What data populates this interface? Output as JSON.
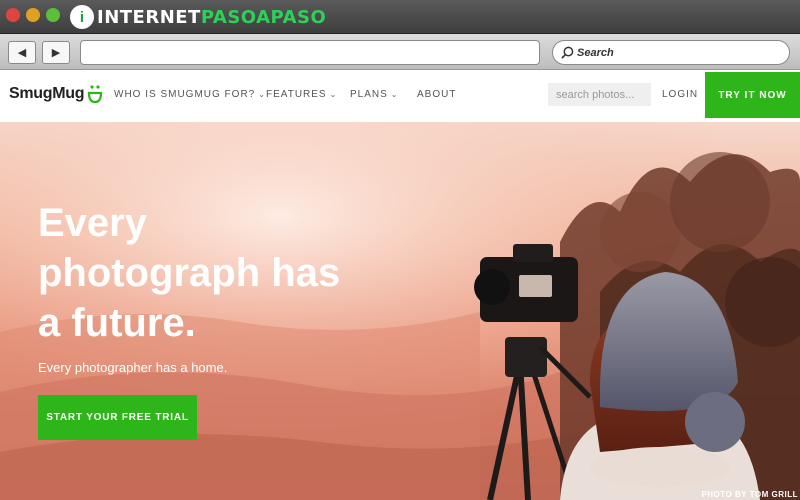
{
  "window": {
    "brand_left": "INTERNET",
    "brand_right": "PASOAPASO",
    "brand_badge": "i"
  },
  "browser": {
    "back_label": "◀",
    "forward_label": "▶",
    "search_placeholder": "Search",
    "url_value": ""
  },
  "site": {
    "logo_text": "SmugMug",
    "nav": [
      {
        "label": "WHO IS SMUGMUG FOR?",
        "has_dropdown": true
      },
      {
        "label": "FEATURES",
        "has_dropdown": true
      },
      {
        "label": "PLANS",
        "has_dropdown": true
      },
      {
        "label": "ABOUT",
        "has_dropdown": false
      }
    ],
    "search_placeholder": "search photos...",
    "login_label": "LOGIN",
    "cta_label": "TRY IT NOW"
  },
  "hero": {
    "title_lines": [
      "Every",
      "photograph has",
      "a future."
    ],
    "subtitle": "Every photographer has a home.",
    "cta_label": "START YOUR FREE TRIAL",
    "photo_credit": "PHOTO BY TOM GRILL"
  },
  "colors": {
    "accent_green": "#2db51a",
    "brand_green": "#2fd05a"
  }
}
